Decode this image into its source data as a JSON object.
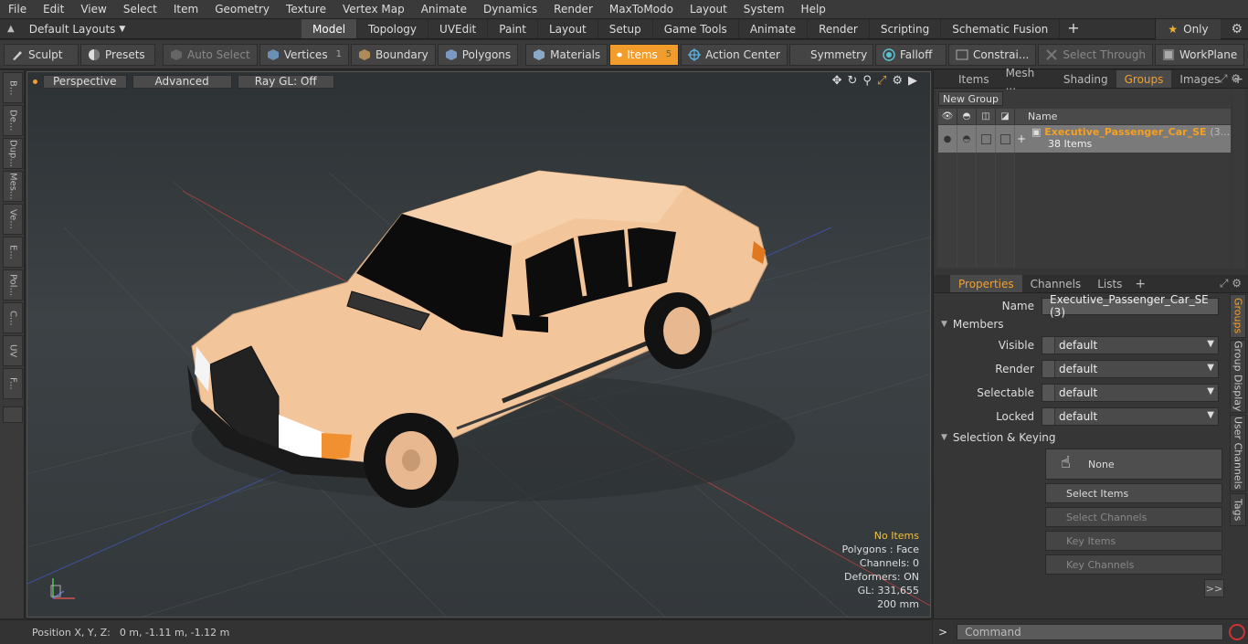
{
  "menu": [
    "File",
    "Edit",
    "View",
    "Select",
    "Item",
    "Geometry",
    "Texture",
    "Vertex Map",
    "Animate",
    "Dynamics",
    "Render",
    "MaxToModo",
    "Layout",
    "System",
    "Help"
  ],
  "layouts": {
    "label": "Default Layouts"
  },
  "tabs": [
    {
      "label": "Model",
      "active": true
    },
    {
      "label": "Topology"
    },
    {
      "label": "UVEdit"
    },
    {
      "label": "Paint"
    },
    {
      "label": "Layout"
    },
    {
      "label": "Setup"
    },
    {
      "label": "Game Tools"
    },
    {
      "label": "Animate"
    },
    {
      "label": "Render"
    },
    {
      "label": "Scripting"
    },
    {
      "label": "Schematic Fusion"
    }
  ],
  "only_label": "Only",
  "toolbar": {
    "sculpt": "Sculpt",
    "presets": "Presets",
    "auto_select": "Auto Select",
    "vertices": "Vertices",
    "vertices_count": "1",
    "boundary": "Boundary",
    "polygons": "Polygons",
    "materials": "Materials",
    "items": "Items",
    "items_count": "5",
    "action_center": "Action Center",
    "symmetry": "Symmetry",
    "falloff": "Falloff",
    "constraints": "Constrai...",
    "select_through": "Select Through",
    "workplane": "WorkPlane"
  },
  "leftstrip": [
    "B...",
    "De...",
    "Dup...",
    "Mes...",
    "Ve...",
    "E...",
    "Pol...",
    "C...",
    "UV",
    "F..."
  ],
  "viewport": {
    "view_mode": "Perspective",
    "shading": "Advanced",
    "raygl": "Ray GL: Off",
    "stats": {
      "items": "No Items",
      "polygons": "Polygons : Face",
      "channels": "Channels: 0",
      "deformers": "Deformers: ON",
      "gl": "GL: 331,655",
      "unit": "200 mm"
    }
  },
  "status": {
    "label": "Position X, Y, Z:",
    "value": "0 m, -1.11 m, -1.12 m"
  },
  "top_panel": {
    "tabs": [
      {
        "label": "Items"
      },
      {
        "label": "Mesh ..."
      },
      {
        "label": "Shading"
      },
      {
        "label": "Groups",
        "active": true
      },
      {
        "label": "Images"
      }
    ],
    "new_group": "New Group",
    "name_header": "Name",
    "group_name": "Executive_Passenger_Car_SE",
    "group_suffix": "(3...",
    "group_items": "38 Items"
  },
  "props_panel": {
    "tabs": [
      {
        "label": "Properties",
        "active": true
      },
      {
        "label": "Channels"
      },
      {
        "label": "Lists"
      }
    ],
    "name_label": "Name",
    "name_value": "Executive_Passenger_Car_SE (3)",
    "members": "Members",
    "visible_label": "Visible",
    "visible_value": "default",
    "render_label": "Render",
    "render_value": "default",
    "selectable_label": "Selectable",
    "selectable_value": "default",
    "locked_label": "Locked",
    "locked_value": "default",
    "sel_keying": "Selection & Keying",
    "none": "None",
    "select_items": "Select Items",
    "select_channels": "Select Channels",
    "key_items": "Key Items",
    "key_channels": "Key Channels",
    "more": ">>"
  },
  "vtabs": [
    "Groups",
    "Group Display",
    "User Channels",
    "Tags"
  ],
  "command": {
    "prompt": ">",
    "placeholder": "Command"
  },
  "colors": {
    "accent": "#f29d2b",
    "car_body": "#f5c9a0"
  }
}
